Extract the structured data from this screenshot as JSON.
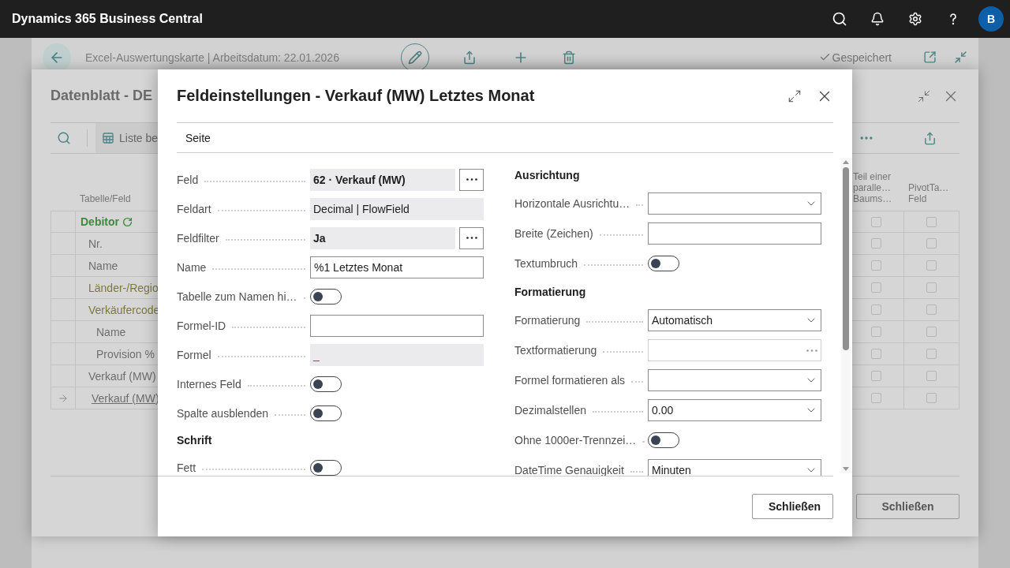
{
  "top_bar": {
    "app_title": "Dynamics 365 Business Central",
    "avatar": "B"
  },
  "card": {
    "title": "Excel-Auswertungskarte | Arbeitsdatum: 22.01.2026",
    "status": "Gespeichert"
  },
  "datasheet": {
    "title": "Datenblatt - DE",
    "toolbar_action": "Liste be",
    "table": {
      "columns": [
        "Tabelle/Feld",
        "Teil einer paralle… Baums…",
        "PivotTa… Feld"
      ],
      "rows": [
        {
          "label": "Debitor",
          "kind": "table",
          "selected": false,
          "cells": [
            {
              "checked": false
            },
            {
              "checked": false
            }
          ],
          "children": [
            {
              "label": "Nr.",
              "kind": "field",
              "selected": false,
              "cells": [
                {
                  "checked": false
                },
                {
                  "checked": false
                }
              ]
            },
            {
              "label": "Name",
              "kind": "field",
              "selected": false,
              "cells": [
                {
                  "checked": false
                },
                {
                  "checked": false
                }
              ]
            },
            {
              "label": "Länder-/Regio",
              "kind": "relation",
              "selected": false,
              "cells": [
                {
                  "checked": false
                },
                {
                  "checked": false
                }
              ]
            },
            {
              "label": "Verkäufercode",
              "kind": "relation",
              "selected": false,
              "cells": [
                {
                  "checked": false
                },
                {
                  "checked": false
                }
              ],
              "children": [
                {
                  "label": "Name",
                  "kind": "field",
                  "selected": false,
                  "cells": [
                    {
                      "checked": false
                    },
                    {
                      "checked": false
                    }
                  ]
                },
                {
                  "label": "Provision %",
                  "kind": "field",
                  "selected": false,
                  "cells": [
                    {
                      "checked": false
                    },
                    {
                      "checked": false
                    }
                  ]
                }
              ]
            },
            {
              "label": "Verkauf (MW)",
              "kind": "field",
              "selected": false,
              "cells": [
                {
                  "checked": false
                },
                {
                  "checked": false
                }
              ]
            },
            {
              "label": "Verkauf (MW)",
              "kind": "field",
              "selected": true,
              "cells": [
                {
                  "checked": false
                },
                {
                  "checked": false
                }
              ]
            }
          ]
        }
      ]
    },
    "close_button": "Schließen"
  },
  "dialog": {
    "title": "Feldeinstellungen - Verkauf (MW) Letztes Monat",
    "section": "Seite",
    "left": [
      {
        "kind": "readonly",
        "label": "Feld",
        "value": "62 · Verkauf (MW)",
        "emphasis": true,
        "lookup": true
      },
      {
        "kind": "readonly",
        "label": "Feldart",
        "value": "Decimal | FlowField",
        "emphasis": false,
        "lookup": false
      },
      {
        "kind": "readonly",
        "label": "Feldfilter",
        "value": "Ja",
        "emphasis": true,
        "lookup": true
      },
      {
        "kind": "input",
        "label": "Name",
        "value": "%1 Letztes Monat"
      },
      {
        "kind": "toggle",
        "label": "Tabelle zum Namen hi…",
        "on": false
      },
      {
        "kind": "input",
        "label": "Formel-ID"
      },
      {
        "kind": "formula",
        "label": "Formel",
        "value": "_"
      },
      {
        "kind": "toggle",
        "label": "Internes Feld",
        "on": false
      },
      {
        "kind": "toggle",
        "label": "Spalte ausblenden",
        "on": false
      },
      {
        "kind": "heading",
        "label": "Schrift"
      },
      {
        "kind": "toggle",
        "label": "Fett",
        "on": false
      }
    ],
    "right": [
      {
        "kind": "heading",
        "label": "Ausrichtung"
      },
      {
        "kind": "select",
        "label": "Horizontale Ausrichtu…"
      },
      {
        "kind": "input",
        "label": "Breite (Zeichen)"
      },
      {
        "kind": "toggle",
        "label": "Textumbruch",
        "on": false
      },
      {
        "kind": "heading",
        "label": "Formatierung"
      },
      {
        "kind": "select",
        "label": "Formatierung",
        "value": "Automatisch"
      },
      {
        "kind": "assist",
        "label": "Textformatierung"
      },
      {
        "kind": "select",
        "label": "Formel formatieren als"
      },
      {
        "kind": "select",
        "label": "Dezimalstellen",
        "value": "0.00"
      },
      {
        "kind": "toggle",
        "label": "Ohne 1000er-Trennzei…",
        "on": false
      },
      {
        "kind": "select",
        "label": "DateTime Genauigkeit",
        "value": "Minuten"
      }
    ],
    "close_button": "Schließen"
  }
}
